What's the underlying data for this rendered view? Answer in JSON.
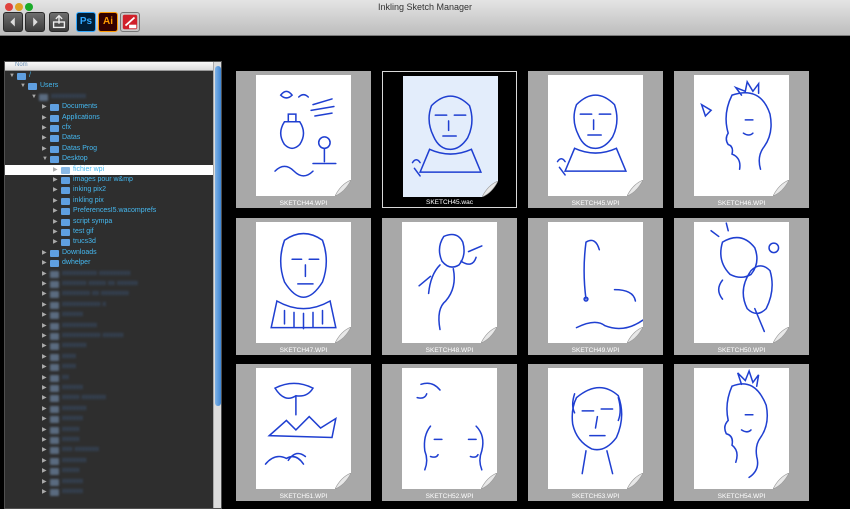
{
  "window": {
    "title": "Inkling Sketch Manager"
  },
  "toolbar": {
    "back_icon": "chevron-left-icon",
    "forward_icon": "chevron-right-icon",
    "export_icon": "export-icon",
    "ps_label": "Ps",
    "ai_label": "Ai",
    "sketch_icon": "sketch-manager-icon",
    "colors": {
      "ps_bg": "#001e36",
      "ps_fg": "#31a8ff",
      "ai_bg": "#330000",
      "ai_fg": "#ff9a00"
    }
  },
  "sidebar": {
    "column_header": "Nom",
    "tree": [
      {
        "label": "/",
        "depth": 0,
        "open": true,
        "icon": "computer-icon"
      },
      {
        "label": "Users",
        "depth": 1,
        "open": true,
        "icon": "folder-icon"
      },
      {
        "label": "",
        "depth": 2,
        "open": true,
        "icon": "home-folder-icon",
        "blurred": true
      },
      {
        "label": "Documents",
        "depth": 3,
        "open": false,
        "icon": "folder-icon"
      },
      {
        "label": "Applications",
        "depth": 3,
        "open": false,
        "icon": "folder-icon"
      },
      {
        "label": "cfx",
        "depth": 3,
        "open": false,
        "icon": "folder-icon"
      },
      {
        "label": "Datas",
        "depth": 3,
        "open": false,
        "icon": "folder-icon"
      },
      {
        "label": "Datas Prog",
        "depth": 3,
        "open": false,
        "icon": "folder-icon"
      },
      {
        "label": "Desktop",
        "depth": 3,
        "open": true,
        "icon": "folder-icon"
      },
      {
        "label": "fichier wpi",
        "depth": 4,
        "open": false,
        "icon": "folder-icon",
        "selected": true
      },
      {
        "label": "images pour w&mp",
        "depth": 4,
        "open": false,
        "icon": "folder-icon"
      },
      {
        "label": "inking pix2",
        "depth": 4,
        "open": false,
        "icon": "folder-icon"
      },
      {
        "label": "inkling pix",
        "depth": 4,
        "open": false,
        "icon": "folder-icon"
      },
      {
        "label": "PreferencesI5.wacomprefs",
        "depth": 4,
        "open": false,
        "icon": "folder-icon"
      },
      {
        "label": "script sympa",
        "depth": 4,
        "open": false,
        "icon": "folder-icon"
      },
      {
        "label": "test gif",
        "depth": 4,
        "open": false,
        "icon": "folder-icon"
      },
      {
        "label": "trucs3d",
        "depth": 4,
        "open": false,
        "icon": "folder-icon"
      },
      {
        "label": "Downloads",
        "depth": 3,
        "open": false,
        "icon": "downloads-folder-icon"
      },
      {
        "label": "dwhelper",
        "depth": 3,
        "open": false,
        "icon": "folder-icon"
      }
    ],
    "blurred_rows": 22
  },
  "gallery": {
    "items": [
      {
        "name": "SKETCH44.WPI",
        "selected": false,
        "sketch": "still-life"
      },
      {
        "name": "SKETCH45.wac",
        "selected": true,
        "sketch": "portrait-bust"
      },
      {
        "name": "SKETCH45.WPI",
        "selected": false,
        "sketch": "portrait-bust"
      },
      {
        "name": "SKETCH46.WPI",
        "selected": false,
        "sketch": "profile-head"
      },
      {
        "name": "SKETCH47.WPI",
        "selected": false,
        "sketch": "bald-head"
      },
      {
        "name": "SKETCH48.WPI",
        "selected": false,
        "sketch": "figure"
      },
      {
        "name": "SKETCH49.WPI",
        "selected": false,
        "sketch": "lines"
      },
      {
        "name": "SKETCH50.WPI",
        "selected": false,
        "sketch": "heads-pair"
      },
      {
        "name": "SKETCH51.WPI",
        "selected": false,
        "sketch": "landscape"
      },
      {
        "name": "SKETCH52.WPI",
        "selected": false,
        "sketch": "faces-duo"
      },
      {
        "name": "SKETCH53.WPI",
        "selected": false,
        "sketch": "portrait-tilt"
      },
      {
        "name": "SKETCH54.WPI",
        "selected": false,
        "sketch": "profile-old"
      }
    ],
    "colors": {
      "ink": "#1f3fd1",
      "tile_bg": "#a8a8a8",
      "selected_paper": "#e3edfb"
    }
  }
}
